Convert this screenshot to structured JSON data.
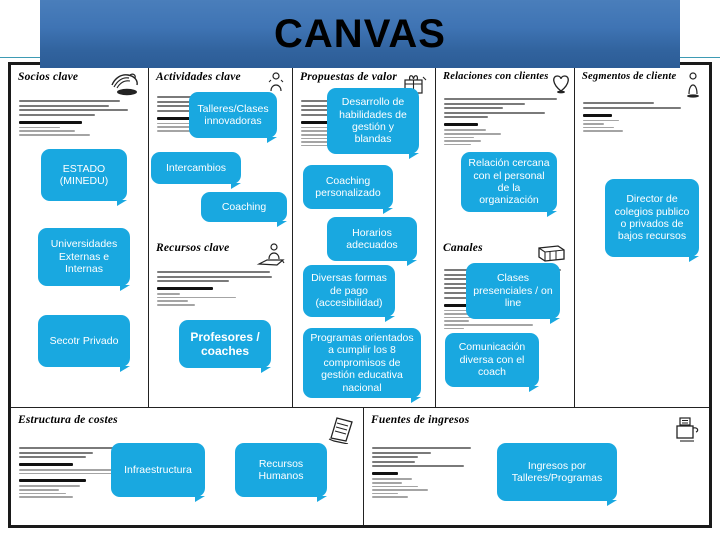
{
  "header": {
    "title": "CANVAS",
    "banner_color": "#3f74b4",
    "title_color": "#000000"
  },
  "theme": {
    "sticky_color": "#19a8e0",
    "sticky_text_color": "#ffffff",
    "frame_color": "#1a1a1a",
    "rule_color": "#3e9bb4"
  },
  "canvas": {
    "blocks": [
      {
        "id": "socios-clave",
        "title": "Socios clave",
        "icon": "handshake-icon"
      },
      {
        "id": "actividades-clave",
        "title": "Actividades clave",
        "icon": "gears-person-icon"
      },
      {
        "id": "propuestas-de-valor",
        "title": "Propuestas de valor",
        "icon": "gift-box-icon"
      },
      {
        "id": "relaciones-con-clientes",
        "title": "Relaciones con clientes",
        "icon": "heart-icon"
      },
      {
        "id": "segmentos-de-cliente",
        "title": "Segmentos de cliente",
        "icon": "person-icon"
      },
      {
        "id": "recursos-clave",
        "title": "Recursos clave",
        "icon": "person-computer-icon"
      },
      {
        "id": "canales",
        "title": "Canales",
        "icon": "truck-icon"
      },
      {
        "id": "estructura-de-costes",
        "title": "Estructura de costes",
        "icon": "notepad-icon"
      },
      {
        "id": "fuentes-de-ingresos",
        "title": "Fuentes de ingresos",
        "icon": "cash-register-icon"
      }
    ]
  },
  "notes": {
    "socios_clave": [
      {
        "text": "ESTADO (MINEDU)",
        "bold": false
      },
      {
        "text": "Universidades Externas e Internas",
        "bold": false
      },
      {
        "text": "Secotr Privado",
        "bold": false
      }
    ],
    "actividades_clave": [
      {
        "text": "Talleres/Clases innovadoras",
        "bold": false
      },
      {
        "text": "Intercambios",
        "bold": false
      },
      {
        "text": "Coaching",
        "bold": false
      }
    ],
    "propuestas_de_valor": [
      {
        "text": "Desarrollo de habilidades de gestión y blandas",
        "bold": false
      },
      {
        "text": "Coaching personalizado",
        "bold": false
      },
      {
        "text": "Horarios adecuados",
        "bold": false
      },
      {
        "text": "Diversas formas de pago (accesibilidad)",
        "bold": false
      },
      {
        "text": "Programas orientados a cumplir los 8 compromisos de gestión educativa nacional",
        "bold": false
      }
    ],
    "relaciones_con_clientes": [
      {
        "text": "Relación cercana con el personal de la organización",
        "bold": false
      }
    ],
    "segmentos_de_cliente": [
      {
        "text": "Director de colegios publico o privados de bajos recursos",
        "bold": false
      }
    ],
    "recursos_clave": [
      {
        "text": "Profesores / coaches",
        "bold": true
      }
    ],
    "canales": [
      {
        "text": "Clases presenciales / on line",
        "bold": false
      },
      {
        "text": "Comunicación diversa con el coach",
        "bold": false
      }
    ],
    "estructura_de_costes": [
      {
        "text": "Infraestructura",
        "bold": false
      },
      {
        "text": "Recursos Humanos",
        "bold": false
      }
    ],
    "fuentes_de_ingresos": [
      {
        "text": "Ingresos por Talleres/Programas",
        "bold": false
      }
    ]
  }
}
